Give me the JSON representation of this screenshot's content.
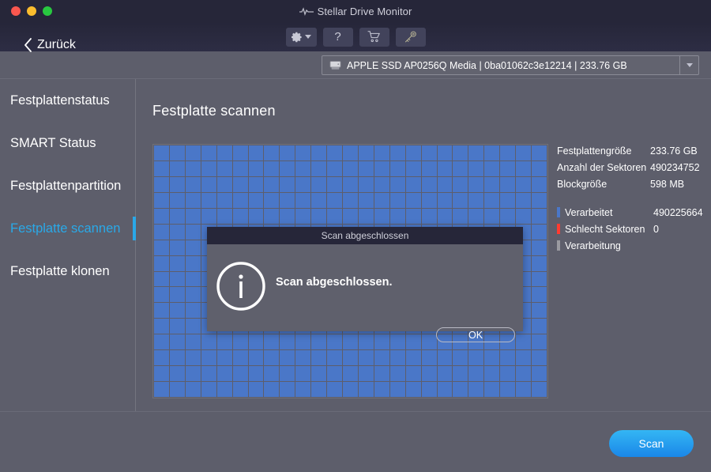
{
  "window": {
    "app_title": "Stellar Drive Monitor",
    "pulse_icon": "pulse-waveform-icon",
    "traffic_lights": [
      {
        "name": "close",
        "color": "#f9574f"
      },
      {
        "name": "minimize",
        "color": "#fbbd2e"
      },
      {
        "name": "zoom",
        "color": "#28c840"
      }
    ]
  },
  "toolbar": {
    "buttons": [
      {
        "name": "settings-button",
        "icon": "gear-icon",
        "label": "",
        "has_dropdown": true
      },
      {
        "name": "help-button",
        "icon": "question-icon",
        "label": "?",
        "has_dropdown": false
      },
      {
        "name": "buy-button",
        "icon": "cart-icon",
        "label": "",
        "has_dropdown": false
      },
      {
        "name": "activate-button",
        "icon": "key-icon",
        "label": "",
        "has_dropdown": false
      }
    ]
  },
  "drive_selector": {
    "icon": "hard-drive-icon",
    "value": "APPLE SSD AP0256Q Media  | 0ba01062c3e12214 | 233.76 GB",
    "name": "APPLE SSD AP0256Q Media",
    "serial": "0ba01062c3e12214",
    "size": "233.76 GB",
    "dropdown_icon": "chevron-down-icon"
  },
  "sidebar": {
    "items": [
      {
        "label": "Festplattenstatus",
        "active": false
      },
      {
        "label": "SMART Status",
        "active": false
      },
      {
        "label": "Festplattenpartition",
        "active": false
      },
      {
        "label": "Festplatte scannen",
        "active": true
      },
      {
        "label": "Festplatte klonen",
        "active": false
      }
    ],
    "active_color": "#29a9e8"
  },
  "main": {
    "page_title": "Festplatte scannen",
    "grid": {
      "columns": 25,
      "rows": 16,
      "cell_color": "#4a77c8",
      "total_cells": 400
    },
    "stats": [
      {
        "label": "Festplattengröße",
        "value": "233.76 GB",
        "swatch": null
      },
      {
        "label": "Anzahl der Sektoren",
        "value": "490234752",
        "swatch": null
      },
      {
        "label": "Blockgröße",
        "value": "598 MB",
        "swatch": null
      }
    ],
    "legend": [
      {
        "label": "Verarbeitet",
        "value": "490225664",
        "swatch": "#4a77c8"
      },
      {
        "label": "Schlecht Sektoren",
        "value": "0",
        "swatch": "#ff3b30"
      },
      {
        "label": "Verarbeitung",
        "value": "",
        "swatch": "#9a9aa0"
      }
    ]
  },
  "dialog": {
    "title": "Scan abgeschlossen",
    "icon": "info-circle-icon",
    "message": "Scan abgeschlossen.",
    "ok_label": "OK"
  },
  "bottom": {
    "back_icon": "chevron-left-icon",
    "back_label": "Zurück",
    "scan_label": "Scan",
    "scan_color": "#1f96ef"
  }
}
